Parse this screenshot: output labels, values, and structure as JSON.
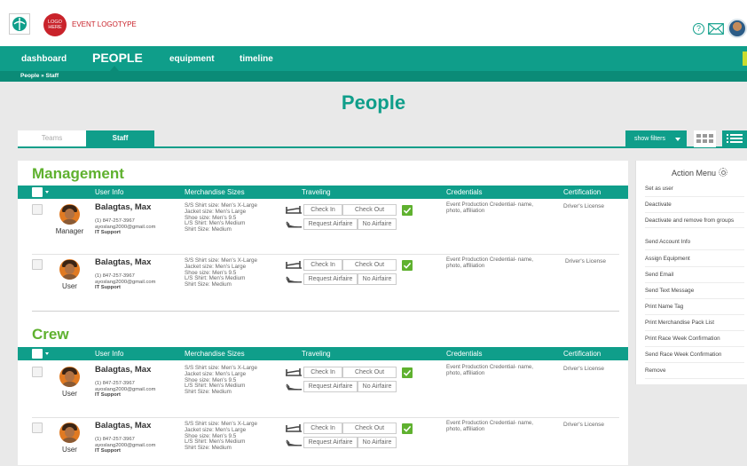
{
  "header": {
    "logo_here": "LOGO HERE",
    "event_logotype": "EVENT LOGOTYPE",
    "help_glyph": "?"
  },
  "nav": {
    "dashboard": "dashboard",
    "people": "PEOPLE",
    "equipment": "equipment",
    "timeline": "timeline"
  },
  "breadcrumb": "People » Staff",
  "page_title": "People",
  "tabs": {
    "teams": "Teams",
    "staff": "Staff"
  },
  "toolbar": {
    "show_filters": "show filters"
  },
  "columns": {
    "user_info": "User Info",
    "merchandise": "Merchandise Sizes",
    "traveling": "Traveling",
    "credentials": "Credentials",
    "certification": "Certification"
  },
  "traveling_buttons": {
    "check_in": "Check In",
    "check_out": "Check Out",
    "request_airfaire": "Request Airfaire",
    "no_airfaire": "No Airfaire"
  },
  "sections": [
    {
      "title": "Management",
      "rows": [
        {
          "name": "Balagtas, Max",
          "phone": "(1) 847-257-3967",
          "email": "ayoslang2000@gmail.com",
          "dept": "IT Support",
          "role": "Manager",
          "merch": [
            "S/S Shirt size: Men's X-Large",
            "Jacket size: Men's Large",
            "Shoe size: Men's 9.5",
            "L/S Shirt: Men's Medium",
            "Shirt Size: Medium"
          ],
          "credentials": "Event Production Credential- name, photo, affiliation",
          "certification": "Driver's License"
        },
        {
          "name": "Balagtas, Max",
          "phone": "(1) 847-257-3967",
          "email": "ayoslang2000@gmail.com",
          "dept": "IT Support",
          "role": "User",
          "merch": [
            "S/S Shirt size: Men's X-Large",
            "Jacket size: Men's Large",
            "Shoe size: Men's 9.5",
            "L/S Shirt: Men's Medium",
            "Shirt Size: Medium"
          ],
          "credentials": "Event Production Credential- name, photo, affiliation",
          "certification": "Driver's License"
        }
      ]
    },
    {
      "title": "Crew",
      "rows": [
        {
          "name": "Balagtas, Max",
          "phone": "(1) 847-257-3967",
          "email": "ayoslang2000@gmail.com",
          "dept": "IT Support",
          "role": "User",
          "merch": [
            "S/S Shirt size: Men's X-Large",
            "Jacket size: Men's Large",
            "Shoe size: Men's 9.5",
            "L/S Shirt: Men's Medium",
            "Shirt Size: Medium"
          ],
          "credentials": "Event Production Credential- name, photo, affiliation",
          "certification": "Driver's License"
        },
        {
          "name": "Balagtas, Max",
          "phone": "(1) 847-257-3967",
          "email": "ayoslang2000@gmail.com",
          "dept": "IT Support",
          "role": "User",
          "merch": [
            "S/S Shirt size: Men's X-Large",
            "Jacket size: Men's Large",
            "Shoe size: Men's 9.5",
            "L/S Shirt: Men's Medium",
            "Shirt Size: Medium"
          ],
          "credentials": "Event Production Credential- name, photo, affiliation",
          "certification": "Driver's License"
        }
      ]
    }
  ],
  "action_menu": {
    "title": "Action Menu",
    "items": [
      "Set as user",
      "Deactivate",
      "Deactivate and remove from groups",
      "Send Account Info",
      "Assign Equipment",
      "Send Email",
      "Send Text Message",
      "Print Name Tag",
      "Print Merchandise Pack List",
      "Print Race Week Confirmation",
      "Send Race Week Confirmation",
      "Remove"
    ]
  },
  "colors": {
    "brand_teal": "#0f9e8a",
    "section_green": "#5fb12f",
    "logo_red": "#c9232b"
  },
  "icons": {
    "app_logo": "leaf-logo-icon",
    "help": "help-icon",
    "mail": "mail-icon",
    "takeoff": "plane-takeoff-icon",
    "landing": "plane-landing-icon",
    "check": "check-icon",
    "gear": "gear-icon",
    "grid_view": "grid-view-icon",
    "list_view": "list-view-icon"
  }
}
